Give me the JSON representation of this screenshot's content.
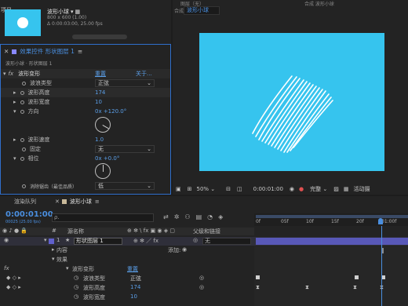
{
  "project": {
    "thumb_title": "波形小球",
    "thumb_dims": "800 x 600 (1.00)",
    "thumb_duration": "Δ 0:00:03:00, 25.00 fps",
    "left_stub": "项目"
  },
  "effects_panel": {
    "tab_label": "效果控件 形状图层 1",
    "breadcrumb": "波形小球 · 形状图层 1",
    "fx_label": "fx",
    "effect_name": "波形变形",
    "reset_label": "重置",
    "about_label": "关于...",
    "props": [
      {
        "label": "波浪类型",
        "value": "正弦"
      },
      {
        "label": "波形高度",
        "value": "174"
      },
      {
        "label": "波形宽度",
        "value": "10"
      },
      {
        "label": "方向",
        "value": "0x +120.0°"
      },
      {
        "label": "波形速度",
        "value": "1.0"
      },
      {
        "label": "固定",
        "value": "无"
      },
      {
        "label": "相位",
        "value": "0x +0.0°"
      },
      {
        "label": "消除锯齿（最佳品质）",
        "value": "低"
      }
    ]
  },
  "composition": {
    "tab_stub": "合成",
    "tab_label": "波形小球",
    "top_stub": "图层（无）",
    "top_right_stub": "合成 波形小球",
    "bg_color": "#36c4ee",
    "zoom": "50%",
    "timecode": "0:00:01:00",
    "quality": "完整",
    "active_camera": "活动摄"
  },
  "timeline": {
    "render_queue_tab": "渲染队列",
    "comp_tab": "波形小球",
    "current_time": "0:00:01:00",
    "frame_info": "00025 (25.00 fps)",
    "search_placeholder": "ρ.",
    "col_num": "#",
    "col_source": "源名称",
    "col_parent": "父级和链接",
    "ruler_labels": [
      "0f",
      "05f",
      "10f",
      "15f",
      "20f",
      "01:00f"
    ],
    "layer": {
      "num": "1",
      "name": "形状图层 1",
      "parent": "无"
    },
    "content_label": "内容",
    "add_label": "添加:",
    "effects_label": "效果",
    "effect_name": "波形变形",
    "reset_label": "重置",
    "sub_props": [
      {
        "label": "波浪类型",
        "value": "正弦"
      },
      {
        "label": "波形高度",
        "value": "174"
      },
      {
        "label": "波形宽度",
        "value": "10"
      }
    ],
    "bottom_stub": "fx"
  }
}
